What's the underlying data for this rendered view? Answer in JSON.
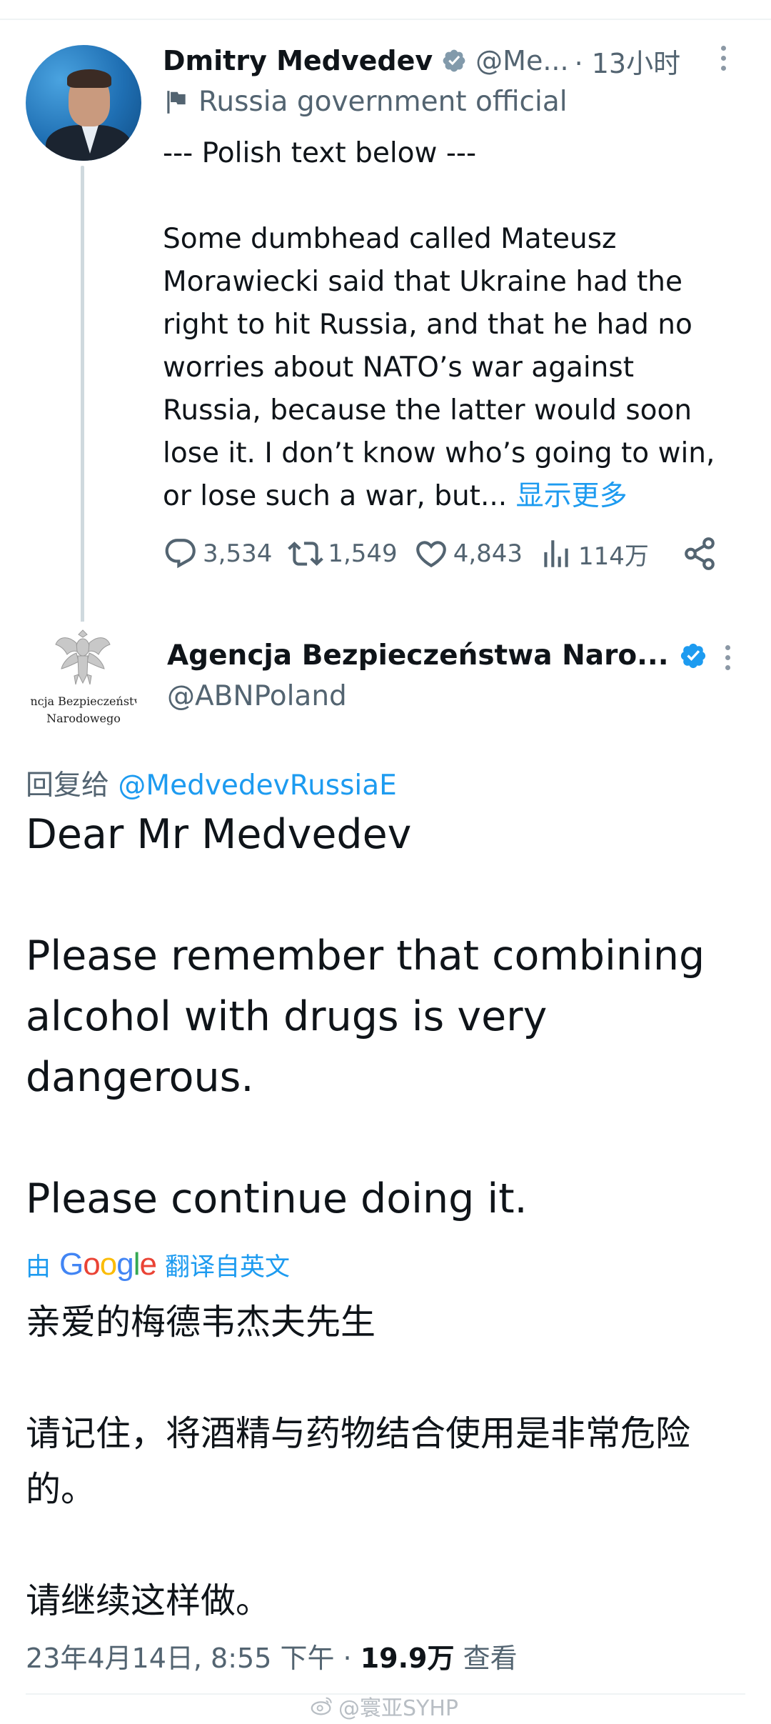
{
  "parent_tweet": {
    "display_name": "Dmitry Medvedev",
    "handle": "@Me...",
    "time": "· 13小时",
    "label": "Russia government official",
    "text_line1": "--- Polish text below ---",
    "text_body": "Some dumbhead called Mateusz Morawiecki said that Ukraine had the right to hit Russia, and that he had no worries about NATO’s war against Russia, because the latter would soon lose it. I don’t know who’s going to win, or lose such a war, but...",
    "show_more": "显示更多",
    "replies": "3,534",
    "retweets": "1,549",
    "likes": "4,843",
    "views": "114万"
  },
  "reply_tweet": {
    "display_name": "Agencja Bezpieczeństwa Naro...",
    "handle": "@ABNPoland",
    "avatar_text_1": "encja Bezpieczeństw",
    "avatar_text_2": "Narodowego",
    "reply_prefix": "回复给",
    "reply_mention": "@MedvedevRussiaE",
    "text_p1": "Dear Mr Medvedev",
    "text_p2": "Please remember that combining alcohol with drugs is very dangerous.",
    "text_p3": "Please continue doing it.",
    "translate_prefix": "由",
    "translate_brand": "Google",
    "translate_suffix": "翻译自英文",
    "translated_p1": "亲爱的梅德韦杰夫先生",
    "translated_p2": "请记住，将酒精与药物结合使用是非常危险的。",
    "translated_p3": "请继续这样做。",
    "date": "23年4月14日, 8:55 下午 · ",
    "views_count": "19.9万",
    "views_label": "查看"
  },
  "watermark": "@寰亚SYHP",
  "colors": {
    "link_blue": "#1d9bf0",
    "secondary_gray": "#536471",
    "text": "#0f1419",
    "divider": "#eff3f4"
  }
}
